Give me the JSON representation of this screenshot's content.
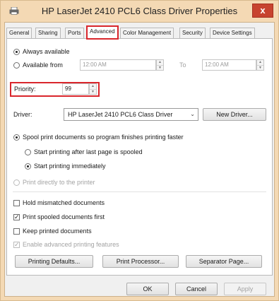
{
  "window": {
    "title": "HP LaserJet 2410 PCL6 Class Driver Properties",
    "close_glyph": "x"
  },
  "tabs": [
    {
      "label": "General"
    },
    {
      "label": "Sharing"
    },
    {
      "label": "Ports"
    },
    {
      "label": "Advanced"
    },
    {
      "label": "Color Management"
    },
    {
      "label": "Security"
    },
    {
      "label": "Device Settings"
    }
  ],
  "active_tab": "Advanced",
  "availability": {
    "always_label": "Always available",
    "from_label": "Available from",
    "from_time": "12:00 AM",
    "to_label": "To",
    "to_time": "12:00 AM",
    "selected": "always"
  },
  "priority": {
    "label": "Priority:",
    "value": "99"
  },
  "driver": {
    "label": "Driver:",
    "value": "HP LaserJet 2410 PCL6 Class Driver",
    "new_button": "New Driver..."
  },
  "spooling": {
    "spool_label": "Spool print documents so program finishes printing faster",
    "after_last_label": "Start printing after last page is spooled",
    "immediately_label": "Start printing immediately",
    "direct_label": "Print directly to the printer"
  },
  "options": {
    "hold_mismatched": {
      "label": "Hold mismatched documents",
      "checked": false
    },
    "spooled_first": {
      "label": "Print spooled documents first",
      "checked": true
    },
    "keep_printed": {
      "label": "Keep printed documents",
      "checked": false
    },
    "advanced_features": {
      "label": "Enable advanced printing features",
      "checked": true
    }
  },
  "buttons": {
    "printing_defaults": "Printing Defaults...",
    "print_processor": "Print Processor...",
    "separator_page": "Separator Page...",
    "ok": "OK",
    "cancel": "Cancel",
    "apply": "Apply"
  },
  "glyphs": {
    "check_mark": "✓",
    "dropdown_arrow": "⌄",
    "spin_up": "▲",
    "spin_down": "▼"
  },
  "colors": {
    "highlight": "#d9262c",
    "title_background": "#f4d9b4",
    "close_button": "#c7432f"
  }
}
